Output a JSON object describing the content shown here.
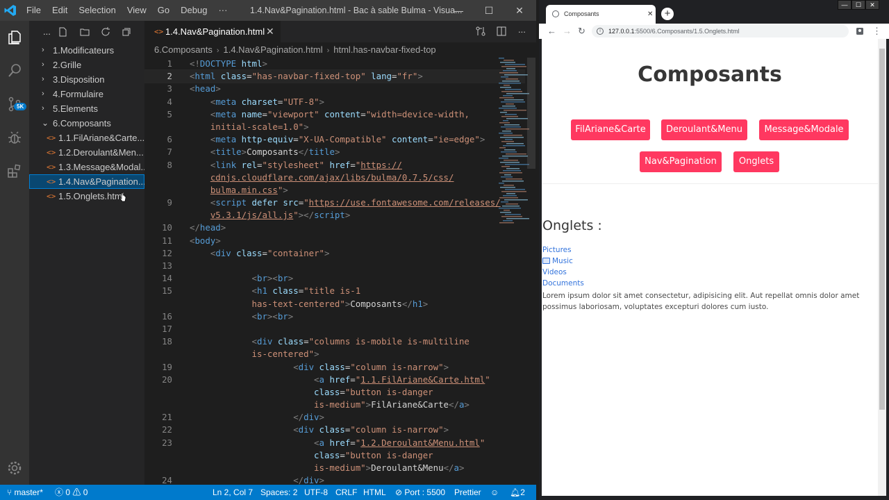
{
  "vscode": {
    "menu": [
      "File",
      "Edit",
      "Selection",
      "View",
      "Go",
      "Debug",
      "···"
    ],
    "window_title": "1.4.Nav&Pagination.html - Bac à sable Bulma - Visua...",
    "window_controls": {
      "minimize": "—",
      "maximize": "☐",
      "close": "✕"
    },
    "activity_badge": "5K",
    "sidebar": {
      "more": "...",
      "tree": [
        {
          "label": "1.Modificateurs",
          "type": "folder",
          "chevron": "›"
        },
        {
          "label": "2.Grille",
          "type": "folder",
          "chevron": "›"
        },
        {
          "label": "3.Disposition",
          "type": "folder",
          "chevron": "›"
        },
        {
          "label": "4.Formulaire",
          "type": "folder",
          "chevron": "›"
        },
        {
          "label": "5.Elements",
          "type": "folder",
          "chevron": "›"
        },
        {
          "label": "6.Composants",
          "type": "folder",
          "chevron": "⌄"
        },
        {
          "label": "1.1.FilAriane&Carte....",
          "type": "file"
        },
        {
          "label": "1.2.Deroulant&Men...",
          "type": "file"
        },
        {
          "label": "1.3.Message&Modal...",
          "type": "file"
        },
        {
          "label": "1.4.Nav&Pagination....",
          "type": "file",
          "selected": true
        },
        {
          "label": "1.5.Onglets.html",
          "type": "file"
        }
      ]
    },
    "tab": {
      "label": "1.4.Nav&Pagination.html",
      "icon": "<>",
      "close": "✕"
    },
    "breadcrumb": [
      "6.Composants",
      "1.4.Nav&Pagination.html",
      "html.has-navbar-fixed-top"
    ],
    "breadcrumb_sep": "›",
    "code_lines": [
      {
        "n": "1",
        "tokens": [
          [
            "p",
            "<!"
          ],
          [
            "t",
            "DOCTYPE"
          ],
          [
            "x",
            " "
          ],
          [
            "a",
            "html"
          ],
          [
            "p",
            ">"
          ]
        ]
      },
      {
        "n": "2",
        "current": true,
        "tokens": [
          [
            "p",
            "<"
          ],
          [
            "t",
            "html"
          ],
          [
            "x",
            " "
          ],
          [
            "a",
            "class"
          ],
          [
            "x",
            "="
          ],
          [
            "s",
            "\"has-navbar-fixed-top\""
          ],
          [
            "x",
            " "
          ],
          [
            "a",
            "lang"
          ],
          [
            "x",
            "="
          ],
          [
            "s",
            "\"fr\""
          ],
          [
            "p",
            ">"
          ]
        ]
      },
      {
        "n": "3",
        "tokens": [
          [
            "p",
            "<"
          ],
          [
            "t",
            "head"
          ],
          [
            "p",
            ">"
          ]
        ]
      },
      {
        "n": "4",
        "tokens": [
          [
            "x",
            "    "
          ],
          [
            "p",
            "<"
          ],
          [
            "t",
            "meta"
          ],
          [
            "x",
            " "
          ],
          [
            "a",
            "charset"
          ],
          [
            "x",
            "="
          ],
          [
            "s",
            "\"UTF-8\""
          ],
          [
            "p",
            ">"
          ]
        ]
      },
      {
        "n": "5",
        "tokens": [
          [
            "x",
            "    "
          ],
          [
            "p",
            "<"
          ],
          [
            "t",
            "meta"
          ],
          [
            "x",
            " "
          ],
          [
            "a",
            "name"
          ],
          [
            "x",
            "="
          ],
          [
            "s",
            "\"viewport\""
          ],
          [
            "x",
            " "
          ],
          [
            "a",
            "content"
          ],
          [
            "x",
            "="
          ],
          [
            "s",
            "\"width=device-width,"
          ]
        ]
      },
      {
        "n": "",
        "tokens": [
          [
            "x",
            "    "
          ],
          [
            "s",
            "initial-scale=1.0\""
          ],
          [
            "p",
            ">"
          ]
        ]
      },
      {
        "n": "6",
        "tokens": [
          [
            "x",
            "    "
          ],
          [
            "p",
            "<"
          ],
          [
            "t",
            "meta"
          ],
          [
            "x",
            " "
          ],
          [
            "a",
            "http-equiv"
          ],
          [
            "x",
            "="
          ],
          [
            "s",
            "\"X-UA-Compatible\""
          ],
          [
            "x",
            " "
          ],
          [
            "a",
            "content"
          ],
          [
            "x",
            "="
          ],
          [
            "s",
            "\"ie=edge\""
          ],
          [
            "p",
            ">"
          ]
        ]
      },
      {
        "n": "7",
        "tokens": [
          [
            "x",
            "    "
          ],
          [
            "p",
            "<"
          ],
          [
            "t",
            "title"
          ],
          [
            "p",
            ">"
          ],
          [
            "x",
            "Composants"
          ],
          [
            "p",
            "</"
          ],
          [
            "t",
            "title"
          ],
          [
            "p",
            ">"
          ]
        ]
      },
      {
        "n": "8",
        "tokens": [
          [
            "x",
            "    "
          ],
          [
            "p",
            "<"
          ],
          [
            "t",
            "link"
          ],
          [
            "x",
            " "
          ],
          [
            "a",
            "rel"
          ],
          [
            "x",
            "="
          ],
          [
            "s",
            "\"stylesheet\""
          ],
          [
            "x",
            " "
          ],
          [
            "a",
            "href"
          ],
          [
            "x",
            "="
          ],
          [
            "s",
            "\""
          ],
          [
            "u",
            "https://"
          ]
        ]
      },
      {
        "n": "",
        "tokens": [
          [
            "x",
            "    "
          ],
          [
            "u",
            "cdnjs.cloudflare.com/ajax/libs/bulma/0.7.5/css/"
          ]
        ]
      },
      {
        "n": "",
        "tokens": [
          [
            "x",
            "    "
          ],
          [
            "u",
            "bulma.min.css"
          ],
          [
            "s",
            "\""
          ],
          [
            "p",
            ">"
          ]
        ]
      },
      {
        "n": "9",
        "tokens": [
          [
            "x",
            "    "
          ],
          [
            "p",
            "<"
          ],
          [
            "t",
            "script"
          ],
          [
            "x",
            " "
          ],
          [
            "a",
            "defer"
          ],
          [
            "x",
            " "
          ],
          [
            "a",
            "src"
          ],
          [
            "x",
            "="
          ],
          [
            "s",
            "\""
          ],
          [
            "u",
            "https://use.fontawesome.com/releases/"
          ]
        ]
      },
      {
        "n": "",
        "tokens": [
          [
            "x",
            "    "
          ],
          [
            "u",
            "v5.3.1/js/all.js"
          ],
          [
            "s",
            "\""
          ],
          [
            "p",
            "></"
          ],
          [
            "t",
            "script"
          ],
          [
            "p",
            ">"
          ]
        ]
      },
      {
        "n": "10",
        "tokens": [
          [
            "p",
            "</"
          ],
          [
            "t",
            "head"
          ],
          [
            "p",
            ">"
          ]
        ]
      },
      {
        "n": "11",
        "tokens": [
          [
            "p",
            "<"
          ],
          [
            "t",
            "body"
          ],
          [
            "p",
            ">"
          ]
        ]
      },
      {
        "n": "12",
        "tokens": [
          [
            "x",
            "    "
          ],
          [
            "p",
            "<"
          ],
          [
            "t",
            "div"
          ],
          [
            "x",
            " "
          ],
          [
            "a",
            "class"
          ],
          [
            "x",
            "="
          ],
          [
            "s",
            "\"container\""
          ],
          [
            "p",
            ">"
          ]
        ]
      },
      {
        "n": "13",
        "tokens": [
          [
            "x",
            ""
          ]
        ]
      },
      {
        "n": "14",
        "tokens": [
          [
            "x",
            "            "
          ],
          [
            "p",
            "<"
          ],
          [
            "t",
            "br"
          ],
          [
            "p",
            "><"
          ],
          [
            "t",
            "br"
          ],
          [
            "p",
            ">"
          ]
        ]
      },
      {
        "n": "15",
        "tokens": [
          [
            "x",
            "            "
          ],
          [
            "p",
            "<"
          ],
          [
            "t",
            "h1"
          ],
          [
            "x",
            " "
          ],
          [
            "a",
            "class"
          ],
          [
            "x",
            "="
          ],
          [
            "s",
            "\"title is-1"
          ]
        ]
      },
      {
        "n": "",
        "tokens": [
          [
            "x",
            "            "
          ],
          [
            "s",
            "has-text-centered\""
          ],
          [
            "p",
            ">"
          ],
          [
            "x",
            "Composants"
          ],
          [
            "p",
            "</"
          ],
          [
            "t",
            "h1"
          ],
          [
            "p",
            ">"
          ]
        ]
      },
      {
        "n": "16",
        "tokens": [
          [
            "x",
            "            "
          ],
          [
            "p",
            "<"
          ],
          [
            "t",
            "br"
          ],
          [
            "p",
            "><"
          ],
          [
            "t",
            "br"
          ],
          [
            "p",
            ">"
          ]
        ]
      },
      {
        "n": "17",
        "tokens": [
          [
            "x",
            ""
          ]
        ]
      },
      {
        "n": "18",
        "tokens": [
          [
            "x",
            "            "
          ],
          [
            "p",
            "<"
          ],
          [
            "t",
            "div"
          ],
          [
            "x",
            " "
          ],
          [
            "a",
            "class"
          ],
          [
            "x",
            "="
          ],
          [
            "s",
            "\"columns is-mobile is-multiline"
          ]
        ]
      },
      {
        "n": "",
        "tokens": [
          [
            "x",
            "            "
          ],
          [
            "s",
            "is-centered\""
          ],
          [
            "p",
            ">"
          ]
        ]
      },
      {
        "n": "19",
        "tokens": [
          [
            "x",
            "                    "
          ],
          [
            "p",
            "<"
          ],
          [
            "t",
            "div"
          ],
          [
            "x",
            " "
          ],
          [
            "a",
            "class"
          ],
          [
            "x",
            "="
          ],
          [
            "s",
            "\"column is-narrow\""
          ],
          [
            "p",
            ">"
          ]
        ]
      },
      {
        "n": "20",
        "tokens": [
          [
            "x",
            "                        "
          ],
          [
            "p",
            "<"
          ],
          [
            "t",
            "a"
          ],
          [
            "x",
            " "
          ],
          [
            "a",
            "href"
          ],
          [
            "x",
            "="
          ],
          [
            "s",
            "\""
          ],
          [
            "u",
            "1.1.FilAriane&Carte.html"
          ],
          [
            "s",
            "\""
          ]
        ]
      },
      {
        "n": "",
        "tokens": [
          [
            "x",
            "                        "
          ],
          [
            "a",
            "class"
          ],
          [
            "x",
            "="
          ],
          [
            "s",
            "\"button is-danger"
          ]
        ]
      },
      {
        "n": "",
        "tokens": [
          [
            "x",
            "                        "
          ],
          [
            "s",
            "is-medium\""
          ],
          [
            "p",
            ">"
          ],
          [
            "x",
            "FilAriane&Carte"
          ],
          [
            "p",
            "</"
          ],
          [
            "t",
            "a"
          ],
          [
            "p",
            ">"
          ]
        ]
      },
      {
        "n": "21",
        "tokens": [
          [
            "x",
            "                    "
          ],
          [
            "p",
            "</"
          ],
          [
            "t",
            "div"
          ],
          [
            "p",
            ">"
          ]
        ]
      },
      {
        "n": "22",
        "tokens": [
          [
            "x",
            "                    "
          ],
          [
            "p",
            "<"
          ],
          [
            "t",
            "div"
          ],
          [
            "x",
            " "
          ],
          [
            "a",
            "class"
          ],
          [
            "x",
            "="
          ],
          [
            "s",
            "\"column is-narrow\""
          ],
          [
            "p",
            ">"
          ]
        ]
      },
      {
        "n": "23",
        "tokens": [
          [
            "x",
            "                        "
          ],
          [
            "p",
            "<"
          ],
          [
            "t",
            "a"
          ],
          [
            "x",
            " "
          ],
          [
            "a",
            "href"
          ],
          [
            "x",
            "="
          ],
          [
            "s",
            "\""
          ],
          [
            "u",
            "1.2.Deroulant&Menu.html"
          ],
          [
            "s",
            "\""
          ]
        ]
      },
      {
        "n": "",
        "tokens": [
          [
            "x",
            "                        "
          ],
          [
            "a",
            "class"
          ],
          [
            "x",
            "="
          ],
          [
            "s",
            "\"button is-danger"
          ]
        ]
      },
      {
        "n": "",
        "tokens": [
          [
            "x",
            "                        "
          ],
          [
            "s",
            "is-medium\""
          ],
          [
            "p",
            ">"
          ],
          [
            "x",
            "Deroulant&Menu"
          ],
          [
            "p",
            "</"
          ],
          [
            "t",
            "a"
          ],
          [
            "p",
            ">"
          ]
        ]
      },
      {
        "n": "24",
        "tokens": [
          [
            "x",
            "                    "
          ],
          [
            "p",
            "</"
          ],
          [
            "t",
            "div"
          ],
          [
            "p",
            ">"
          ]
        ]
      }
    ],
    "status": {
      "branch": "master*",
      "errors": "0",
      "warnings": "0",
      "position": "Ln 2, Col 7",
      "spaces": "Spaces: 2",
      "encoding": "UTF-8",
      "eol": "CRLF",
      "language": "HTML",
      "port": "Port : 5500",
      "formatter": "Prettier",
      "notifications": "2"
    }
  },
  "chrome": {
    "tab_title": "Composants",
    "tab_close": "✕",
    "new_tab": "+",
    "url_host": "127.0.0.1",
    "url_path": ":5500/6.Composants/1.5.Onglets.html",
    "page": {
      "title": "Composants",
      "buttons": [
        "FilAriane&Carte",
        "Deroulant&Menu",
        "Message&Modale",
        "Nav&Pagination",
        "Onglets"
      ],
      "section_title": "Onglets :",
      "tabs": [
        "Pictures",
        "Music",
        "Videos",
        "Documents"
      ],
      "paragraph": "Lorem ipsum dolor sit amet consectetur, adipisicing elit. Aut repellat omnis dolor amet possimus laboriosam, voluptates excepturi dolores cum iusto."
    },
    "colors": {
      "button": "#ff3860",
      "link": "#3273dc"
    }
  }
}
